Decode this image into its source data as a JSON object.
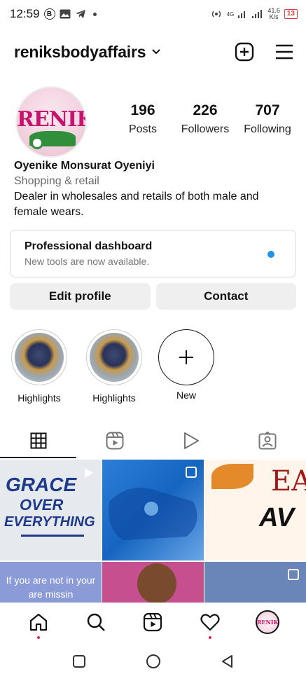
{
  "status_bar": {
    "time": "12:59",
    "b_badge": "B",
    "network": "4G",
    "speed_value": "41.6",
    "speed_unit": "K/s",
    "battery": "13"
  },
  "header": {
    "username": "reniksbodyaffairs"
  },
  "profile": {
    "avatar_text": "RENIK",
    "posts_count": "196",
    "posts_label": "Posts",
    "followers_count": "226",
    "followers_label": "Followers",
    "following_count": "707",
    "following_label": "Following",
    "name": "Oyenike Monsurat Oyeniyi",
    "category": "Shopping & retail",
    "bio": "Dealer in wholesales and retails of both male and female wears."
  },
  "dashboard": {
    "title": "Professional dashboard",
    "subtitle": "New tools are now available."
  },
  "buttons": {
    "edit_profile": "Edit profile",
    "contact": "Contact"
  },
  "highlights": [
    {
      "label": "Highlights"
    },
    {
      "label": "Highlights"
    },
    {
      "label": "New"
    }
  ],
  "grid": {
    "post1": {
      "line1": "GRACE",
      "line2": "OVER",
      "line3": "EVERYTHING"
    },
    "post3": {
      "line1": "EA",
      "line2": "AV"
    },
    "post4": {
      "text": "If you are not in your are missin"
    }
  },
  "bottom_nav_avatar_text": "RENIK",
  "colors": {
    "accent_blue": "#2193e8",
    "button_bg": "#efefef",
    "notification_red": "#e0245e"
  }
}
